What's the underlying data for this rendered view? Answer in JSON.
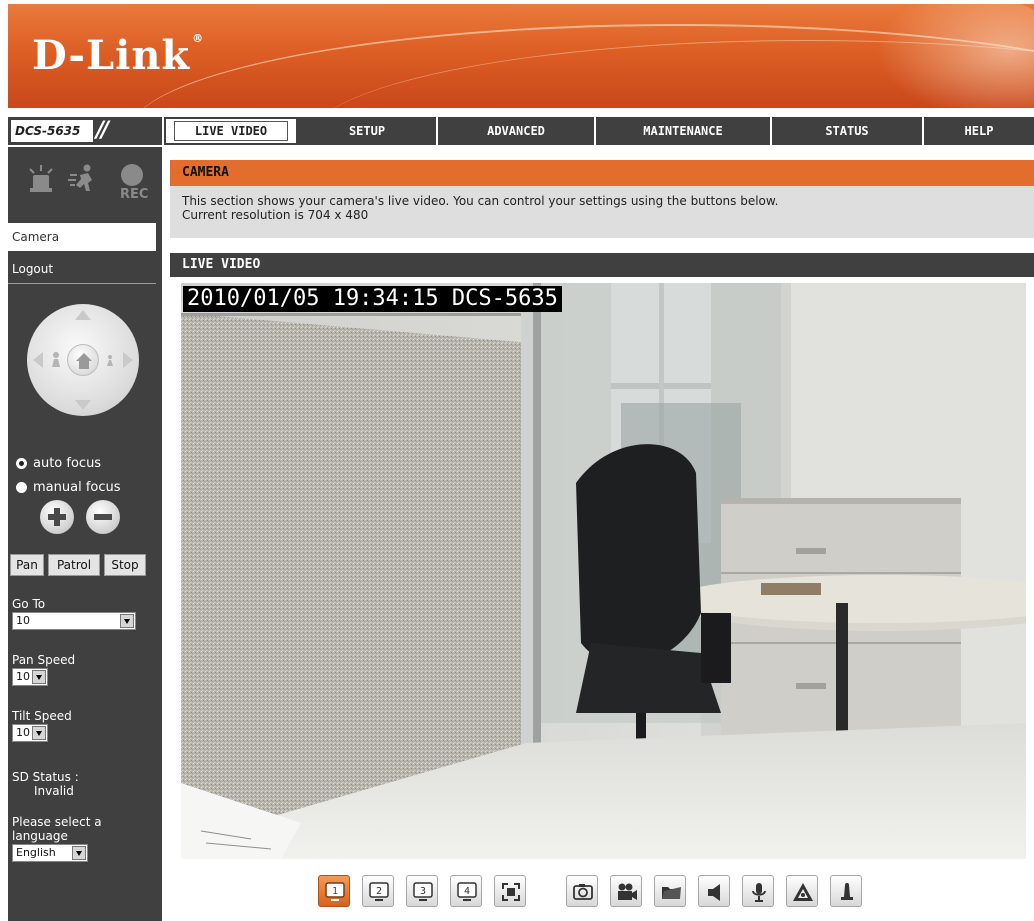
{
  "brand": {
    "logo": "D-Link",
    "reg": "®"
  },
  "model": "DCS-5635",
  "nav_tabs": [
    {
      "label": "LIVE VIDEO",
      "active": true
    },
    {
      "label": "SETUP"
    },
    {
      "label": "ADVANCED"
    },
    {
      "label": "MAINTENANCE"
    },
    {
      "label": "STATUS"
    },
    {
      "label": "HELP"
    }
  ],
  "status_icons": [
    "alarm-icon",
    "motion-icon",
    "rec-icon"
  ],
  "status_rec_label": "REC",
  "sidebar": {
    "menu_camera": "Camera",
    "menu_logout": "Logout",
    "focus": {
      "auto": "auto focus",
      "manual": "manual focus",
      "selected": "auto"
    },
    "buttons": {
      "pan": "Pan",
      "patrol": "Patrol",
      "stop": "Stop"
    },
    "goto_label": "Go To",
    "goto_value": "10",
    "pan_speed_label": "Pan Speed",
    "pan_speed_value": "10",
    "tilt_speed_label": "Tilt Speed",
    "tilt_speed_value": "10",
    "sd_status_label": "SD Status :",
    "sd_status_value": "Invalid",
    "language_label_line1": "Please select a",
    "language_label_line2": "language",
    "language_value": "English"
  },
  "camera": {
    "title": "CAMERA",
    "desc_line1": "This section shows your camera's live video. You can control your settings using the buttons below.",
    "desc_line2": "Current resolution is 704 x 480"
  },
  "live": {
    "title": "LIVE VIDEO",
    "osd": "2010/01/05 19:34:15 DCS-5635"
  },
  "toolbar": [
    {
      "icon": "view-1-icon",
      "label": "1",
      "active": true
    },
    {
      "icon": "view-2-icon",
      "label": "2"
    },
    {
      "icon": "view-3-icon",
      "label": "3"
    },
    {
      "icon": "view-4-icon",
      "label": "4"
    },
    {
      "icon": "fullscreen-icon"
    },
    {
      "icon": "snapshot-icon"
    },
    {
      "icon": "record-icon"
    },
    {
      "icon": "folder-icon"
    },
    {
      "icon": "speaker-icon"
    },
    {
      "icon": "microphone-icon"
    },
    {
      "icon": "digital-output-icon"
    },
    {
      "icon": "alarm-light-icon"
    }
  ],
  "colors": {
    "orange": "#e26d2d",
    "dark_gray": "#404040",
    "light_gray": "#dedede"
  }
}
